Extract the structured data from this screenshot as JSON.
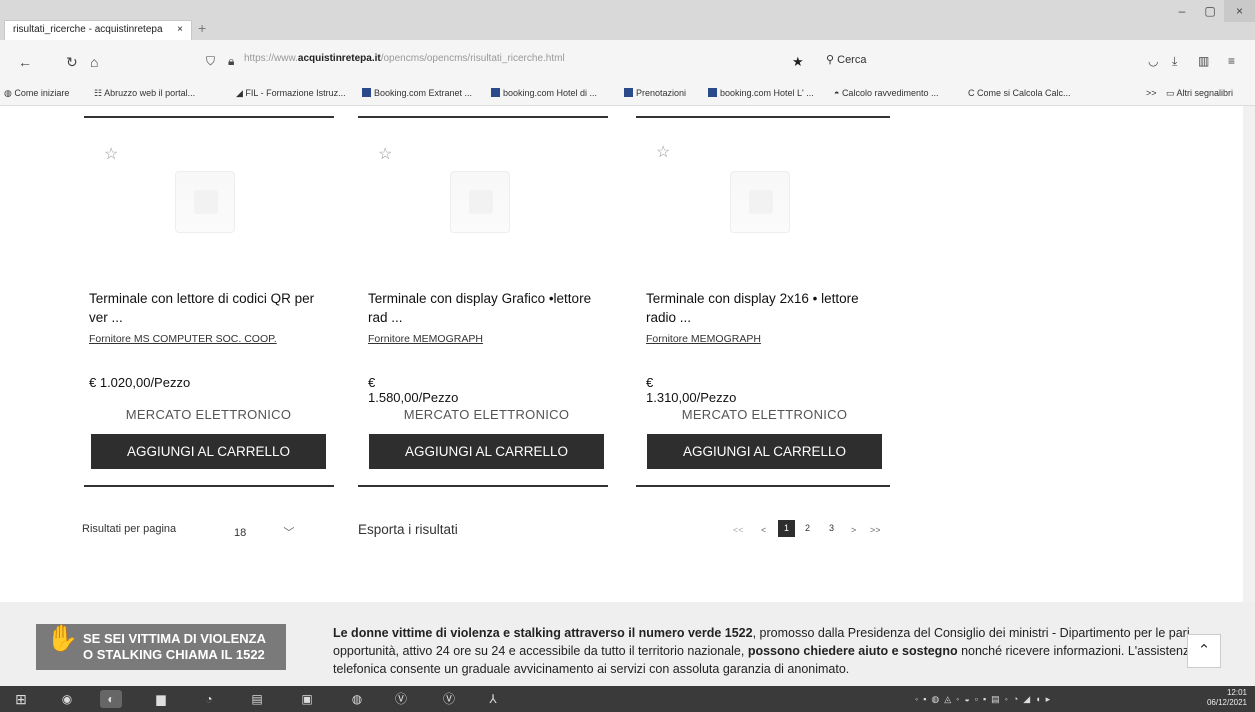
{
  "browser": {
    "tab_title": "risultati_ricerche - acquistinretepa",
    "tab_close": "×",
    "new_tab": "+",
    "win_min": "–",
    "win_max": "▢",
    "win_close": "×",
    "url_prefix": "https://www.",
    "url_domain": "acquistinretepa.it",
    "url_path": "/opencms/opencms/risultati_ricerche.html",
    "search_placeholder": "Cerca",
    "bookmarks": [
      "Come iniziare",
      "Abruzzo web il portal...",
      "FIL - Formazione Istruz...",
      "Booking.com Extranet ...",
      "booking.com Hotel di ...",
      "Prenotazioni",
      "booking.com Hotel L' ...",
      "Calcolo ravvedimento ...",
      "Come si Calcola Calc..."
    ],
    "other_bookmarks": "Altri segnalibri",
    "overflow": ">>"
  },
  "products": [
    {
      "title": "Terminale con lettore di codici QR per ver ...",
      "supplier": "Fornitore MS COMPUTER SOC. COOP.",
      "price": "€ 1.020,00/Pezzo",
      "market": "MERCATO ELETTRONICO",
      "button": "AGGIUNGI AL CARRELLO"
    },
    {
      "title": "Terminale con display Grafico •lettore rad ...",
      "supplier": "Fornitore MEMOGRAPH",
      "price": "€ 1.580,00/Pezzo",
      "market": "MERCATO ELETTRONICO",
      "button": "AGGIUNGI AL CARRELLO"
    },
    {
      "title": "Terminale con display 2x16 • lettore radio ...",
      "supplier": "Fornitore MEMOGRAPH",
      "price": "€ 1.310,00/Pezzo",
      "market": "MERCATO ELETTRONICO",
      "button": "AGGIUNGI AL CARRELLO"
    }
  ],
  "results": {
    "per_page_label": "Risultati per pagina",
    "per_page_value": "18",
    "export_label": "Esporta i risultati",
    "pager": [
      "<<",
      "<",
      "1",
      "2",
      "3",
      ">",
      ">>"
    ],
    "current_page": "1"
  },
  "footer": {
    "banner_line1": "SE SEI VITTIMA DI VIOLENZA",
    "banner_line2": "O STALKING CHIAMA IL 1522",
    "notice_bold1": "Le donne vittime di violenza e stalking attraverso il numero verde 1522",
    "notice_text1": ", promosso dalla Presidenza del Consiglio dei ministri - Dipartimento per le pari opportunità, attivo 24 ore su 24 e accessibile da tutto il territorio nazionale, ",
    "notice_bold2": "possono chiedere aiuto e sostegno",
    "notice_text2": " nonché ricevere informazioni. L'assistenza telefonica consente un graduale avvicinamento ai servizi con assoluta garanzia di anonimato."
  },
  "taskbar": {
    "time": "12:01",
    "date": "06/12/2021"
  },
  "colors": {
    "button_bg": "#2e2e2e",
    "banner_bg": "#7a7a7a",
    "accent_blue": "#2b4a8a"
  }
}
